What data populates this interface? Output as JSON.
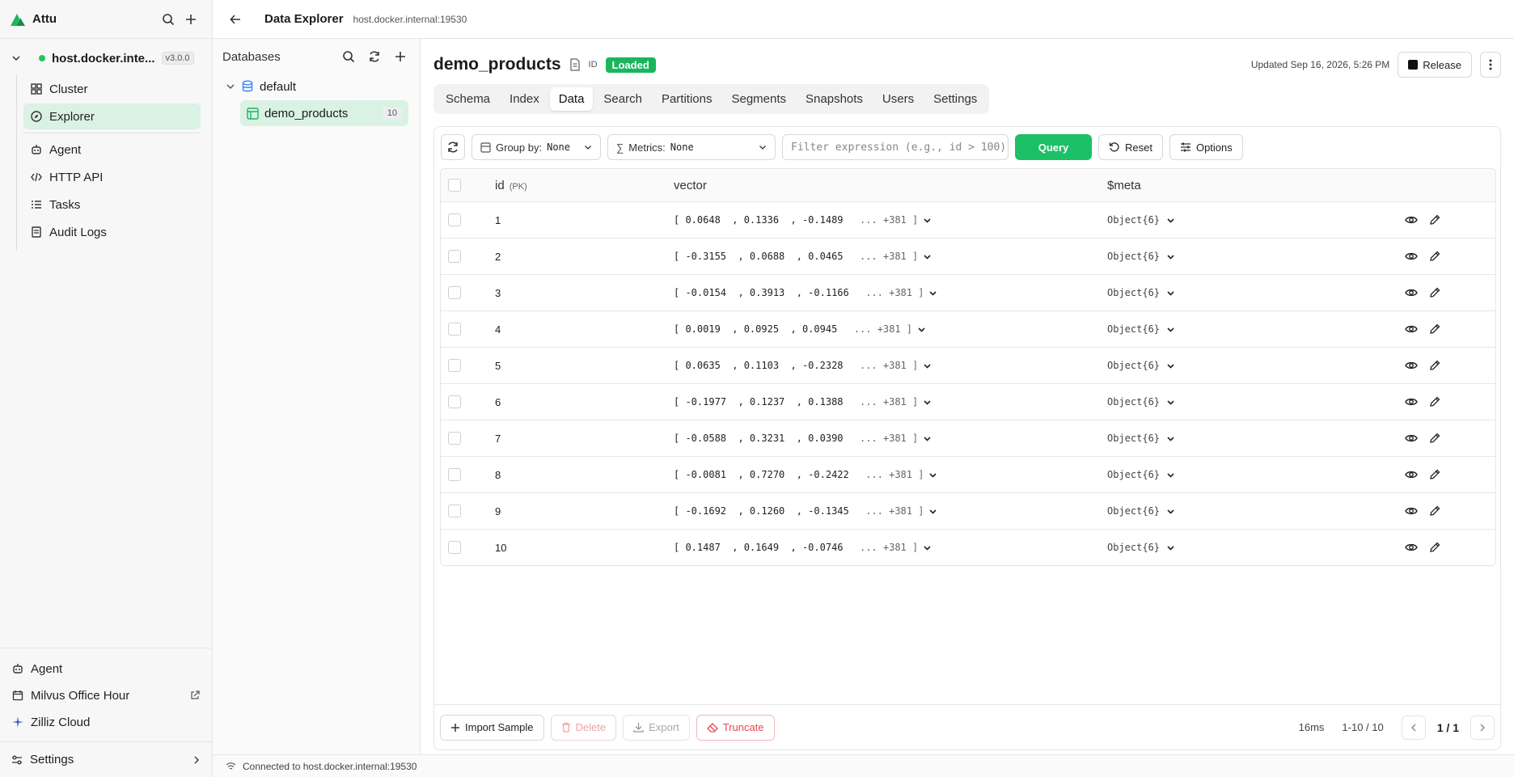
{
  "app": {
    "name": "Attu"
  },
  "sidebar": {
    "connection": {
      "name": "host.docker.inte...",
      "version": "v3.0.0"
    },
    "items": [
      {
        "label": "Cluster",
        "icon": "grid-icon"
      },
      {
        "label": "Explorer",
        "icon": "compass-icon",
        "active": true
      },
      {
        "label": "Agent",
        "icon": "bot-icon"
      },
      {
        "label": "HTTP API",
        "icon": "code-icon"
      },
      {
        "label": "Tasks",
        "icon": "list-icon"
      },
      {
        "label": "Audit Logs",
        "icon": "log-icon"
      }
    ],
    "bottom": [
      {
        "label": "Agent",
        "icon": "bot-icon"
      },
      {
        "label": "Milvus Office Hour",
        "icon": "calendar-icon"
      },
      {
        "label": "Zilliz Cloud",
        "icon": "zilliz-icon"
      }
    ],
    "settings_label": "Settings"
  },
  "topbar": {
    "title": "Data Explorer",
    "subtitle": "host.docker.internal:19530"
  },
  "databases": {
    "title": "Databases",
    "db_name": "default",
    "collection": {
      "name": "demo_products",
      "count": "10"
    }
  },
  "collection": {
    "title": "demo_products",
    "id_label": "ID",
    "status": "Loaded",
    "updated": "Updated Sep 16, 2026, 5:26 PM",
    "release_label": "Release"
  },
  "tabs": [
    "Schema",
    "Index",
    "Data",
    "Search",
    "Partitions",
    "Segments",
    "Snapshots",
    "Users",
    "Settings"
  ],
  "active_tab": "Data",
  "toolbar": {
    "group_label": "Group by:",
    "group_value": "None",
    "metrics_label": "Metrics:",
    "metrics_value": "None",
    "filter_placeholder": "Filter expression (e.g., id > 100)",
    "query_label": "Query",
    "reset_label": "Reset",
    "options_label": "Options"
  },
  "table": {
    "headers": {
      "id": "id",
      "pk": "(PK)",
      "vector": "vector",
      "meta": "$meta"
    },
    "rows": [
      {
        "id": "1",
        "vector": "[ 0.0648  , 0.1336  , -0.1489 ",
        "more": " ... +381 ]",
        "meta": "Object{6}"
      },
      {
        "id": "2",
        "vector": "[ -0.3155  , 0.0688  , 0.0465 ",
        "more": " ... +381 ]",
        "meta": "Object{6}"
      },
      {
        "id": "3",
        "vector": "[ -0.0154  , 0.3913  , -0.1166 ",
        "more": " ... +381 ]",
        "meta": "Object{6}"
      },
      {
        "id": "4",
        "vector": "[ 0.0019  , 0.0925  , 0.0945 ",
        "more": " ... +381 ]",
        "meta": "Object{6}"
      },
      {
        "id": "5",
        "vector": "[ 0.0635  , 0.1103  , -0.2328 ",
        "more": " ... +381 ]",
        "meta": "Object{6}"
      },
      {
        "id": "6",
        "vector": "[ -0.1977  , 0.1237  , 0.1388 ",
        "more": " ... +381 ]",
        "meta": "Object{6}"
      },
      {
        "id": "7",
        "vector": "[ -0.0588  , 0.3231  , 0.0390 ",
        "more": " ... +381 ]",
        "meta": "Object{6}"
      },
      {
        "id": "8",
        "vector": "[ -0.0081  , 0.7270  , -0.2422 ",
        "more": " ... +381 ]",
        "meta": "Object{6}"
      },
      {
        "id": "9",
        "vector": "[ -0.1692  , 0.1260  , -0.1345 ",
        "more": " ... +381 ]",
        "meta": "Object{6}"
      },
      {
        "id": "10",
        "vector": "[ 0.1487  , 0.1649  , -0.0746 ",
        "more": " ... +381 ]",
        "meta": "Object{6}"
      }
    ]
  },
  "footer": {
    "import_label": "Import Sample",
    "delete_label": "Delete",
    "export_label": "Export",
    "truncate_label": "Truncate",
    "latency": "16ms",
    "range": "1-10 / 10",
    "page": "1 / 1"
  },
  "status": {
    "connected": "Connected to host.docker.internal:19530"
  },
  "colors": {
    "accent": "#1cc066",
    "active_bg": "#d9f2e4",
    "danger": "#e5484d"
  }
}
